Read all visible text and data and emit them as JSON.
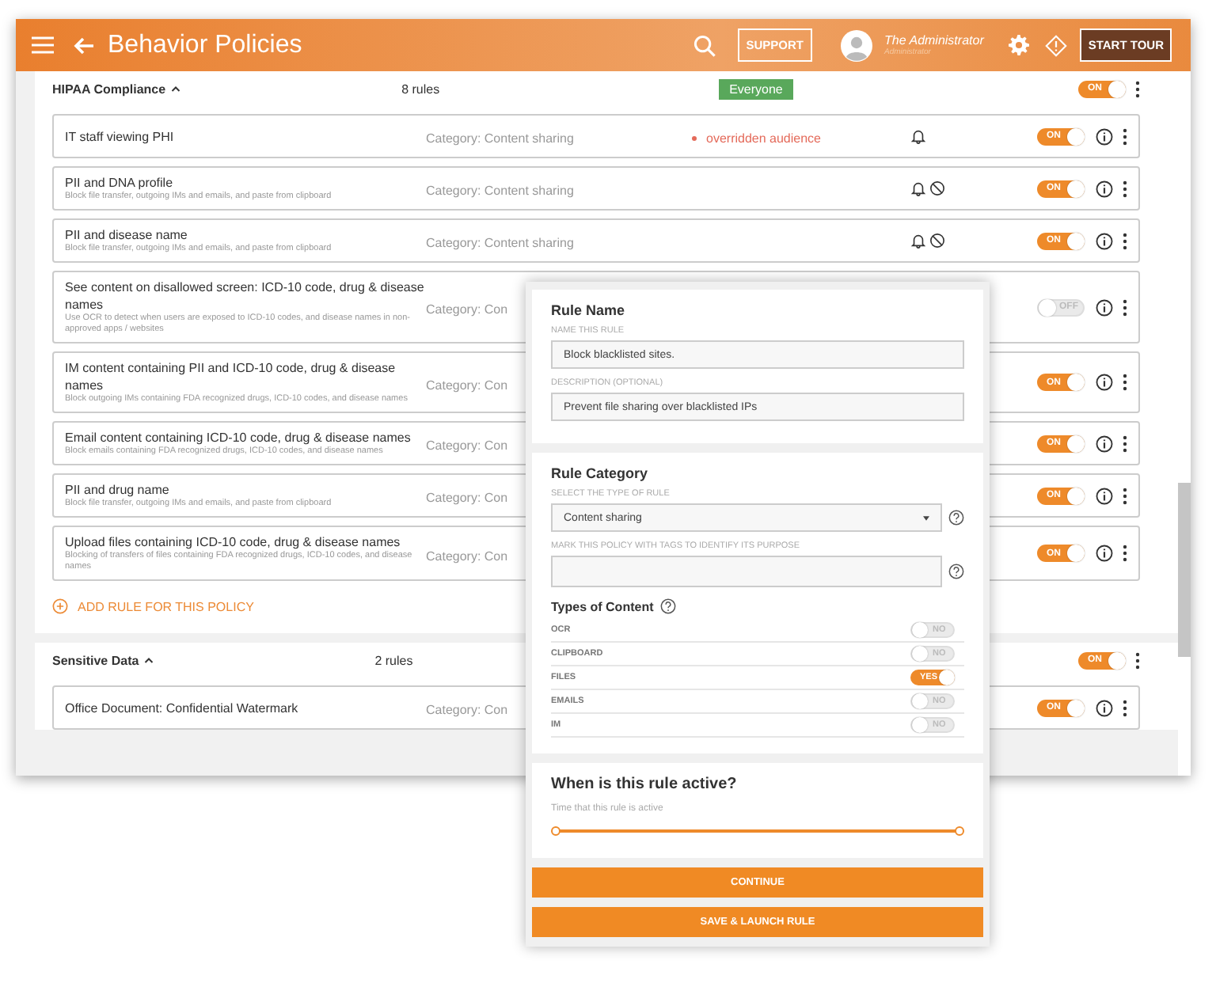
{
  "header": {
    "title": "Behavior Policies",
    "support_label": "SUPPORT",
    "user_name": "The Administrator",
    "user_role": "Administrator",
    "tour_label": "START TOUR"
  },
  "policies": [
    {
      "name": "HIPAA Compliance",
      "count": "8 rules",
      "audience": "Everyone",
      "toggle": {
        "on": true,
        "label": "ON"
      },
      "add_label": "ADD RULE FOR THIS POLICY",
      "rules": [
        {
          "name": "IT staff viewing PHI",
          "category": "Category: Content sharing",
          "note": "overridden audience",
          "alert": true,
          "blocked": false,
          "toggle": {
            "on": true,
            "label": "ON"
          }
        },
        {
          "name": "PII and DNA profile",
          "description": "Block file transfer, outgoing IMs and emails, and paste from clipboard",
          "category": "Category: Content sharing",
          "alert": true,
          "blocked": true,
          "toggle": {
            "on": true,
            "label": "ON"
          }
        },
        {
          "name": "PII and disease name",
          "description": "Block file transfer, outgoing IMs and emails, and paste from clipboard",
          "category": "Category: Content sharing",
          "alert": true,
          "blocked": true,
          "toggle": {
            "on": true,
            "label": "ON"
          }
        },
        {
          "name": "See content on disallowed screen: ICD-10 code, drug & disease names",
          "description": "Use OCR to detect when users are exposed to ICD-10 codes, and disease names in non-approved apps / websites",
          "category": "Category: Con",
          "toggle": {
            "on": false,
            "label": "OFF"
          }
        },
        {
          "name": "IM content containing PII and ICD-10 code, drug & disease names",
          "description": "Block outgoing IMs containing FDA recognized drugs, ICD-10 codes, and disease names",
          "category": "Category: Con",
          "toggle": {
            "on": true,
            "label": "ON"
          }
        },
        {
          "name": "Email content containing ICD-10 code, drug & disease names",
          "description": "Block emails containing FDA recognized drugs, ICD-10 codes, and disease names",
          "category": "Category: Con",
          "toggle": {
            "on": true,
            "label": "ON"
          }
        },
        {
          "name": "PII and drug name",
          "description": "Block file transfer, outgoing IMs and emails, and paste from clipboard",
          "category": "Category: Con",
          "toggle": {
            "on": true,
            "label": "ON"
          }
        },
        {
          "name": "Upload files containing ICD-10 code, drug & disease names",
          "description": "Blocking of transfers of files containing FDA recognized drugs, ICD-10 codes, and disease names",
          "category": "Category: Con",
          "toggle": {
            "on": true,
            "label": "ON"
          }
        }
      ]
    },
    {
      "name": "Sensitive Data",
      "count": "2 rules",
      "toggle": {
        "on": true,
        "label": "ON"
      },
      "rules": [
        {
          "name": "Office Document: Confidential Watermark",
          "category": "Category: Con",
          "toggle": {
            "on": true,
            "label": "ON"
          }
        }
      ]
    }
  ],
  "panel": {
    "rule_name": {
      "title": "Rule Name",
      "name_label": "NAME THIS RULE",
      "name_value": "Block blacklisted sites.",
      "description_label": "DESCRIPTION (OPTIONAL)",
      "description_value": "Prevent file sharing over blacklisted IPs"
    },
    "rule_category": {
      "title": "Rule Category",
      "type_label": "SELECT THE TYPE OF RULE",
      "type_value": "Content sharing",
      "tags_label": "MARK THIS POLICY WITH TAGS TO IDENTIFY ITS PURPOSE",
      "content_title": "Types of Content",
      "content_types": [
        {
          "label": "OCR",
          "on": false,
          "toggle_label": "NO"
        },
        {
          "label": "CLIPBOARD",
          "on": false,
          "toggle_label": "NO"
        },
        {
          "label": "FILES",
          "on": true,
          "toggle_label": "YES"
        },
        {
          "label": "EMAILS",
          "on": false,
          "toggle_label": "NO"
        },
        {
          "label": "IM",
          "on": false,
          "toggle_label": "NO"
        }
      ]
    },
    "schedule": {
      "title": "When is this rule active?",
      "label": "Time that this rule is active",
      "level": 1
    },
    "buttons": [
      "CONTINUE",
      "SAVE & LAUNCH RULE"
    ]
  }
}
